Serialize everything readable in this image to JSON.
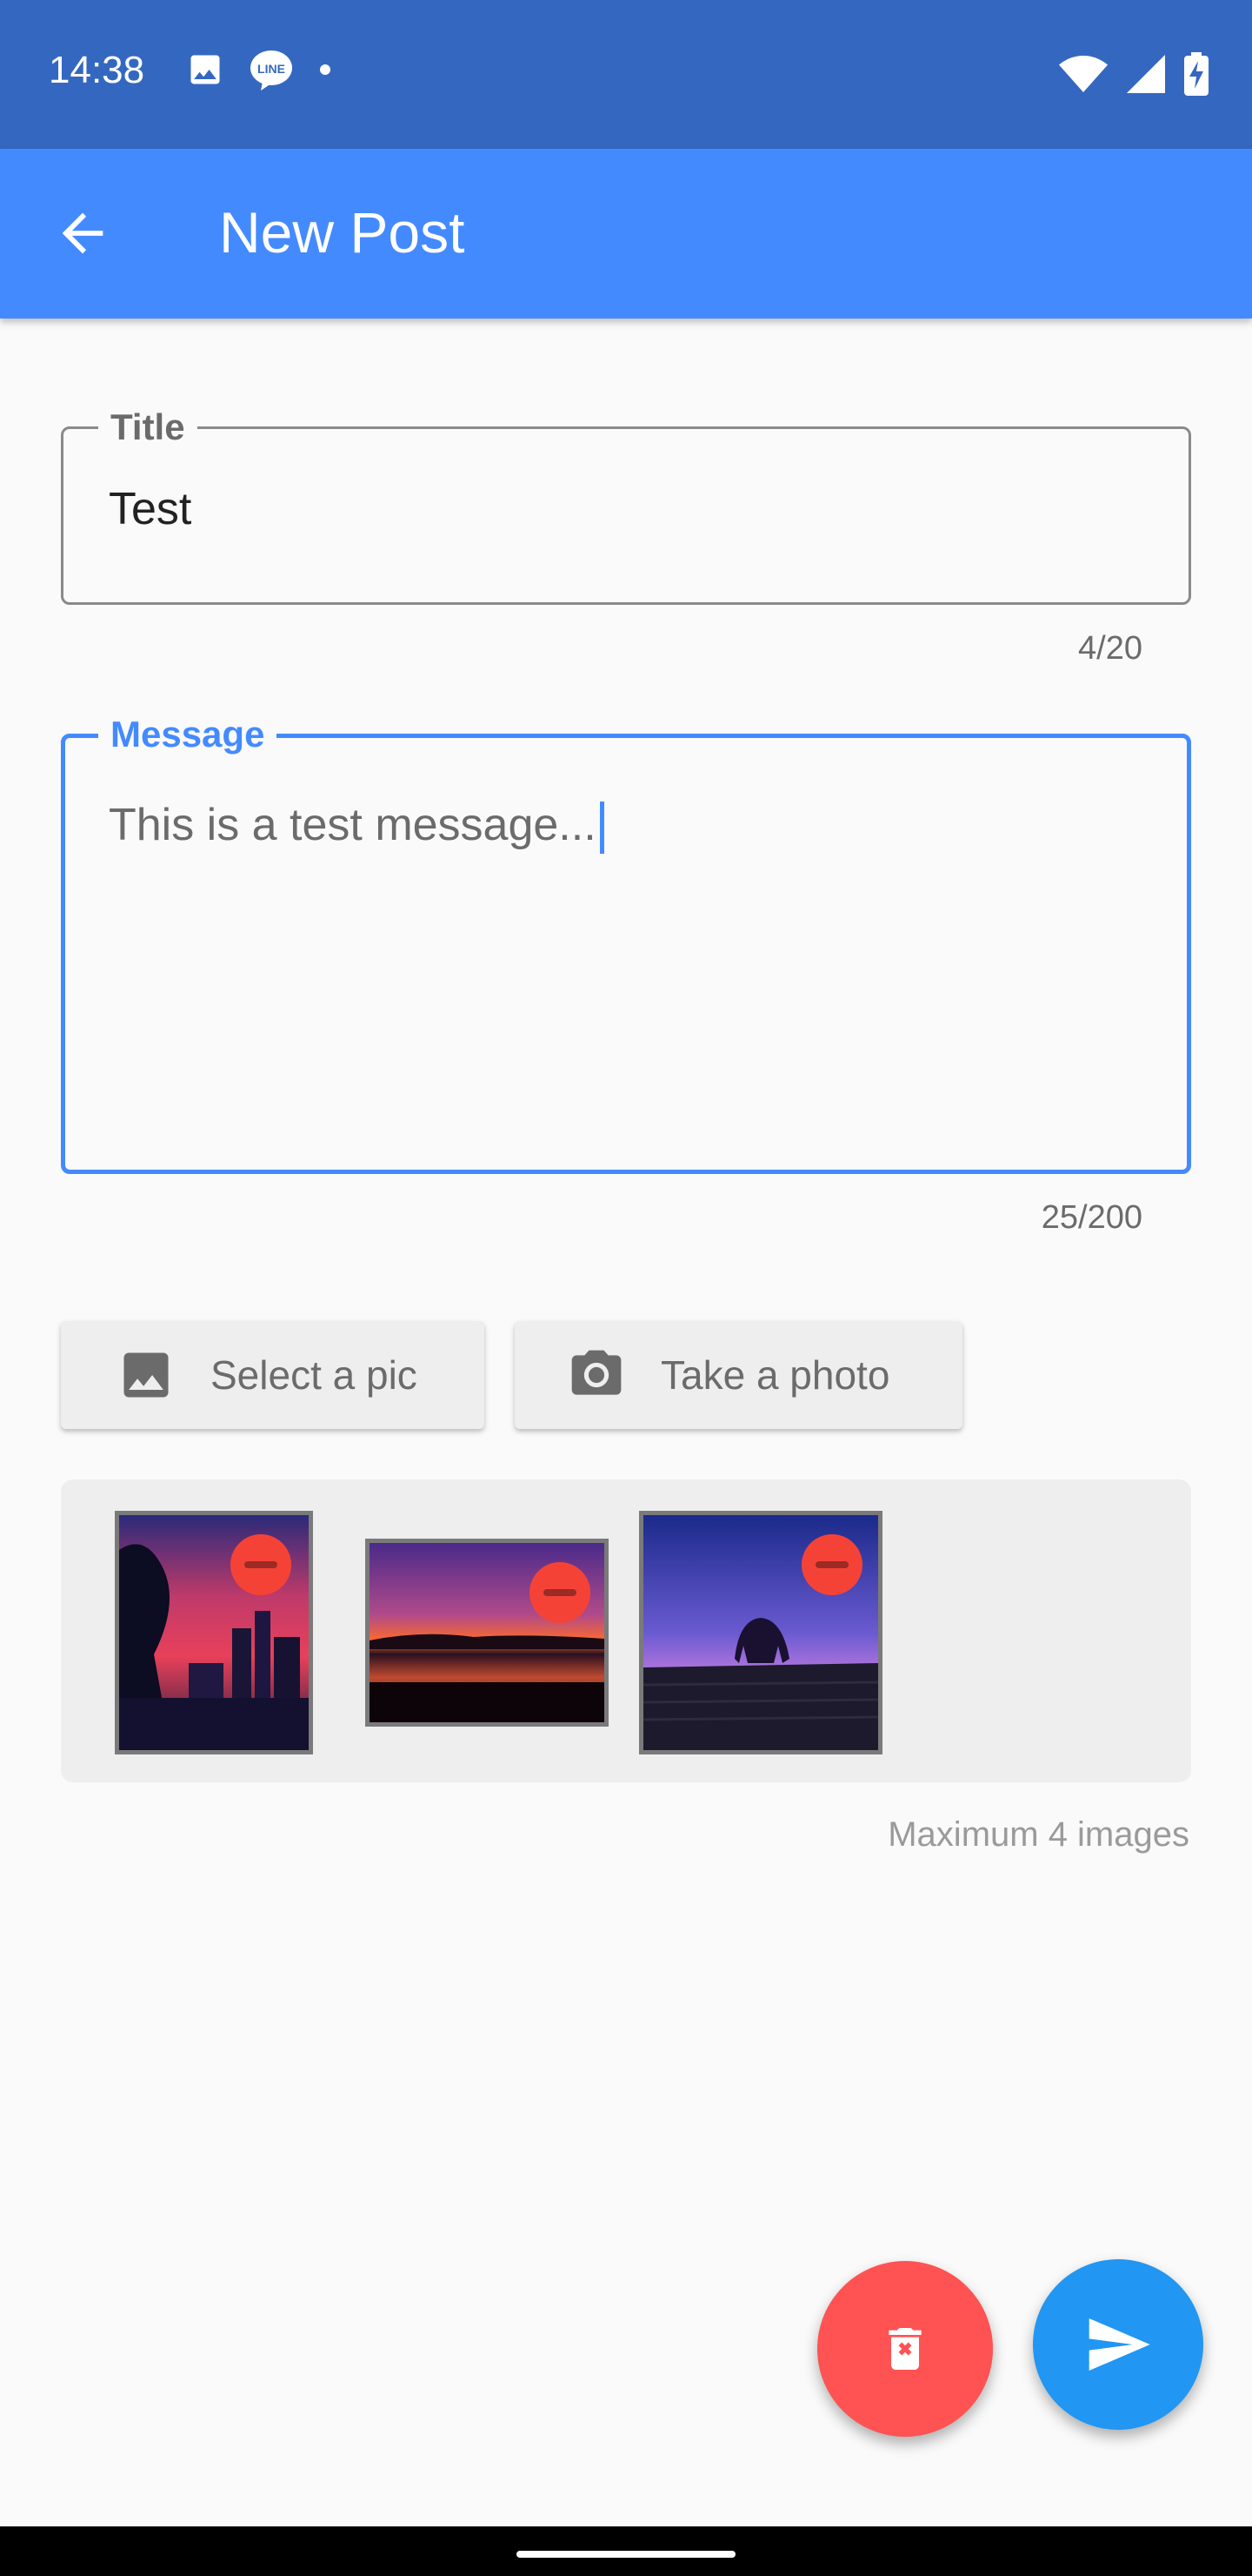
{
  "status_bar": {
    "time": "14:38",
    "left_icons": [
      "image-icon",
      "line-icon",
      "dot-icon"
    ],
    "right_icons": [
      "wifi-icon",
      "signal-icon",
      "battery-charging-icon"
    ]
  },
  "app_bar": {
    "back_icon": "arrow-back-icon",
    "title": "New Post",
    "color": "#448aff"
  },
  "form": {
    "title_field": {
      "label": "Title",
      "value": "Test",
      "counter": "4/20"
    },
    "message_field": {
      "label": "Message",
      "value": "This is a test message...",
      "counter": "25/200",
      "focused": true
    }
  },
  "actions": {
    "select_pic_label": "Select a pic",
    "select_pic_icon": "image-icon",
    "take_photo_label": "Take a photo",
    "take_photo_icon": "camera-icon"
  },
  "images": {
    "count": 3,
    "items": [
      {
        "name": "city-sunset"
      },
      {
        "name": "lake-sunset"
      },
      {
        "name": "elephant-statue-dusk"
      }
    ],
    "max_note": "Maximum 4 images"
  },
  "fabs": {
    "delete_icon": "delete-forever-icon",
    "delete_color": "#ff5252",
    "send_icon": "send-icon",
    "send_color": "#2196f3"
  }
}
